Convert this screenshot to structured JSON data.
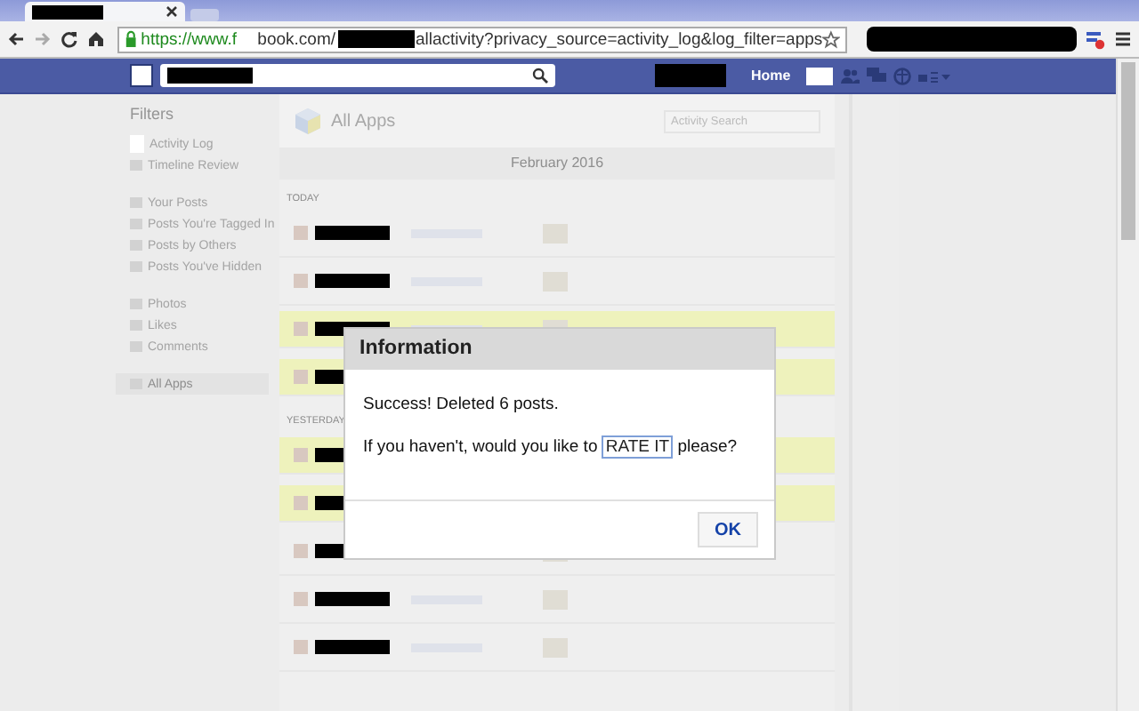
{
  "browser": {
    "url": {
      "scheme": "https://www.f",
      "host_rest": "book.com/",
      "path": "allactivity?privacy_source=activity_log&log_filter=apps"
    }
  },
  "header": {
    "nav": [
      {
        "label": "Home"
      }
    ]
  },
  "sidebar": {
    "title": "Filters",
    "groups": [
      [
        {
          "label": "Activity Log",
          "selected": false
        },
        {
          "label": "Timeline Review",
          "selected": false
        }
      ],
      [
        {
          "label": "Your Posts",
          "selected": false
        },
        {
          "label": "Posts You're Tagged In",
          "selected": false
        },
        {
          "label": "Posts by Others",
          "selected": false
        },
        {
          "label": "Posts You've Hidden",
          "selected": false
        }
      ],
      [
        {
          "label": "Photos",
          "selected": false
        },
        {
          "label": "Likes",
          "selected": false
        },
        {
          "label": "Comments",
          "selected": false
        }
      ],
      [
        {
          "label": "All Apps",
          "selected": true
        }
      ]
    ]
  },
  "main": {
    "title": "All Apps",
    "search": {
      "placeholder": "Activity Search"
    },
    "month": "February 2016",
    "sections": [
      {
        "label": "TODAY",
        "rows": [
          {
            "highlighted": false
          },
          {
            "highlighted": false
          },
          {
            "highlighted": true
          },
          {
            "highlighted": true
          }
        ]
      },
      {
        "label": "YESTERDAY",
        "rows": [
          {
            "highlighted": true
          },
          {
            "highlighted": true
          },
          {
            "highlighted": false
          },
          {
            "highlighted": false
          },
          {
            "highlighted": false
          }
        ]
      }
    ]
  },
  "dialog": {
    "title": "Information",
    "message": "Success! Deleted 6 posts.",
    "prompt_before": "If you haven't, would you like to",
    "link": "RATE IT",
    "prompt_after": "please?",
    "button": "OK"
  }
}
